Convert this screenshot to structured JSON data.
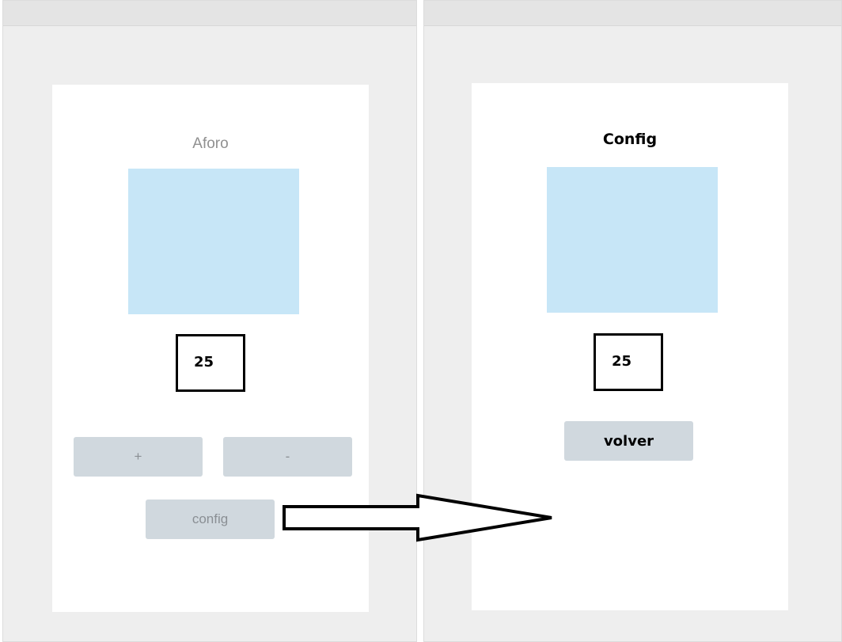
{
  "screens": {
    "left": {
      "title": "Aforo",
      "counter_value": "25",
      "buttons": {
        "plus": "+",
        "minus": "-",
        "config": "config"
      }
    },
    "right": {
      "title": "Config",
      "counter_value": "25",
      "buttons": {
        "volver": "volver"
      }
    }
  },
  "colors": {
    "frame_bg": "#eeeeee",
    "image_placeholder": "#c7e6f7",
    "button_bg": "#d0d8de",
    "arrow_stroke": "#000000"
  }
}
